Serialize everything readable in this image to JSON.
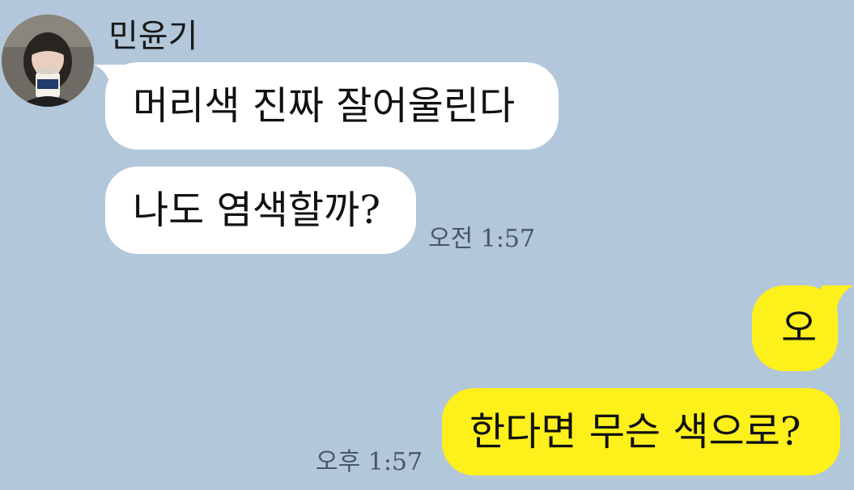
{
  "chat": {
    "sender_name": "민윤기",
    "colors": {
      "background": "#b2c7da",
      "incoming_bubble": "#ffffff",
      "outgoing_bubble": "#fef01b",
      "timestamp_text": "#4b5563"
    },
    "messages": [
      {
        "direction": "incoming",
        "text": "머리색 진짜 잘어울린다"
      },
      {
        "direction": "incoming",
        "text": "나도 염색할까?",
        "time": "오전 1:57"
      },
      {
        "direction": "outgoing",
        "text": "오"
      },
      {
        "direction": "outgoing",
        "text": "한다면 무슨 색으로?",
        "time": "오후 1:57"
      }
    ]
  }
}
